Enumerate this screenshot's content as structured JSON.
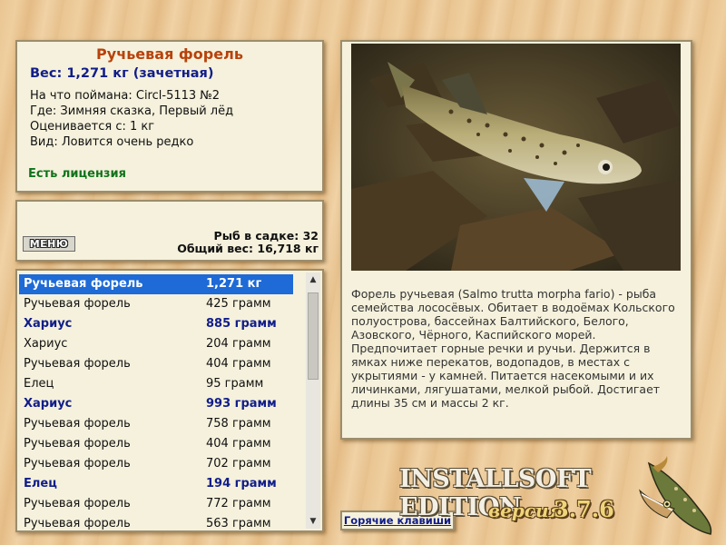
{
  "info": {
    "title": "Ручьевая форель",
    "weight": "Вес: 1,271 кг (зачетная)",
    "caught_on": "На что поймана: Circl-5113 №2",
    "where": "Где: Зимняя сказка, Первый лёд",
    "valued_from": "Оценивается с: 1 кг",
    "kind": "Вид: Ловится очень редко",
    "license": "Есть лицензия"
  },
  "stats": {
    "menu_label": "МЕНЮ",
    "fish_in_keepnet": "Рыб в садке: 32",
    "total_weight": "Общий вес: 16,718 кг"
  },
  "catch_list": [
    {
      "name": "Ручьевая форель",
      "weight": "1,271 кг",
      "style": "selected"
    },
    {
      "name": "Ручьевая форель",
      "weight": "425 грамм",
      "style": "normal"
    },
    {
      "name": "Хариус",
      "weight": "885 грамм",
      "style": "bold"
    },
    {
      "name": "Хариус",
      "weight": "204 грамм",
      "style": "normal"
    },
    {
      "name": "Ручьевая форель",
      "weight": "404 грамм",
      "style": "normal"
    },
    {
      "name": "Елец",
      "weight": "95 грамм",
      "style": "normal"
    },
    {
      "name": "Хариус",
      "weight": "993 грамм",
      "style": "bold"
    },
    {
      "name": "Ручьевая форель",
      "weight": "758 грамм",
      "style": "normal"
    },
    {
      "name": "Ручьевая форель",
      "weight": "404 грамм",
      "style": "normal"
    },
    {
      "name": "Ручьевая форель",
      "weight": "702 грамм",
      "style": "normal"
    },
    {
      "name": "Елец",
      "weight": "194 грамм",
      "style": "bold"
    },
    {
      "name": "Ручьевая форель",
      "weight": "772 грамм",
      "style": "normal"
    },
    {
      "name": "Ручьевая форель",
      "weight": "563 грамм",
      "style": "normal"
    }
  ],
  "description": "Форель ручьевая (Salmo trutta morpha fario) - рыба семейства лососёвых. Обитает в водоёмах Кольского полуострова, бассейнах Балтийского, Белого, Азовского, Чёрного, Каспийского морей. Предпочитает горные речки и ручьи. Держится в ямках ниже перекатов, водопадов, в местах с укрытиями - у камней. Питается насекомыми и их личинками, лягушатами, мелкой рыбой. Достигает длины 35 см и массы 2 кг.",
  "hotkeys_label": "Горячие клавиши",
  "brand": {
    "edition": "INSTALLSOFT EDITION",
    "version_word": "версия",
    "version_number": "3.7.6"
  },
  "colors": {
    "title": "#b8420b",
    "weight": "#111d8a",
    "license": "#11731b",
    "selection": "#1e6ad6"
  }
}
